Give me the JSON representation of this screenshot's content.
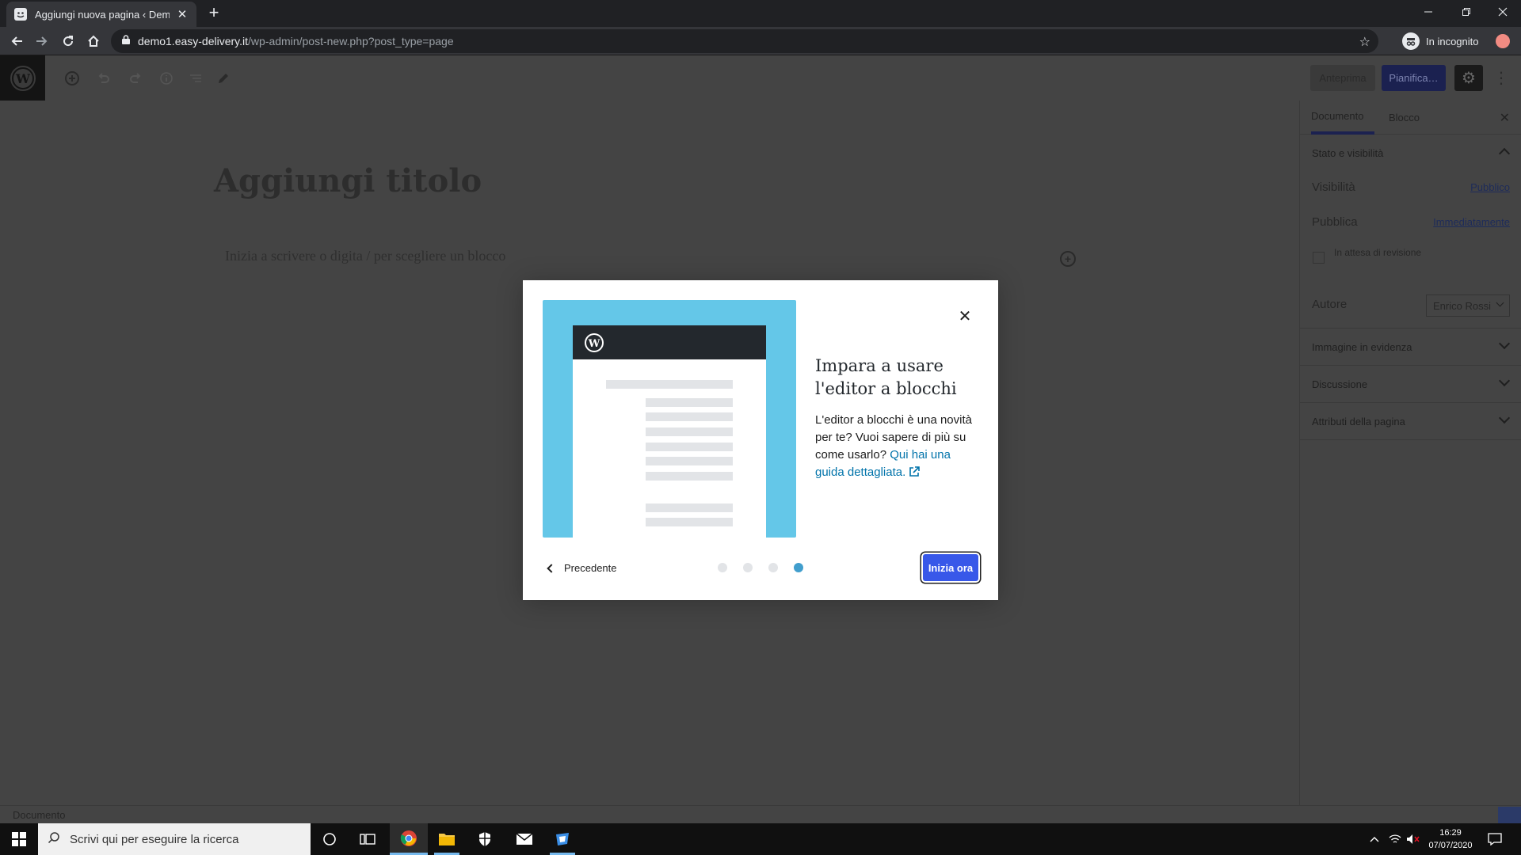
{
  "browser": {
    "tab_title": "Aggiungi nuova pagina ‹ Demo F",
    "url_host": "demo1.easy-delivery.it",
    "url_path": "/wp-admin/post-new.php?post_type=page",
    "incognito_label": "In incognito"
  },
  "editor": {
    "title_placeholder": "Aggiungi titolo",
    "body_placeholder": "Inizia a scrivere o digita / per scegliere un blocco",
    "preview_label": "Anteprima",
    "schedule_label": "Pianifica…"
  },
  "sidebar": {
    "tabs": [
      "Documento",
      "Blocco"
    ],
    "status_panel": {
      "title": "Stato e visibilità",
      "visibility_label": "Visibilità",
      "visibility_value": "Pubblico",
      "publish_label": "Pubblica",
      "publish_value": "Immediatamente",
      "pending_label": "In attesa di revisione",
      "author_label": "Autore",
      "author_value": "Enrico Rossi"
    },
    "panels": [
      "Immagine in evidenza",
      "Discussione",
      "Attributi della pagina"
    ]
  },
  "statusbar": {
    "label": "Documento"
  },
  "modal": {
    "heading": "Impara a usare l'editor a blocchi",
    "body_text": "L'editor a blocchi è una novità per te? Vuoi sapere di più su come usarlo?",
    "link_text": "Qui hai una guida dettagliata.",
    "prev_label": "Precedente",
    "start_label": "Inizia ora",
    "page_count": 4,
    "current_page": 4
  },
  "taskbar": {
    "search_placeholder": "Scrivi qui per eseguire la ricerca",
    "time": "16:29",
    "date": "07/07/2020"
  },
  "colors": {
    "wp_admin_blue": "#1b2150",
    "modal_button": "#3858e9",
    "illustration_bg": "#64c7e8",
    "link": "#0073aa"
  }
}
